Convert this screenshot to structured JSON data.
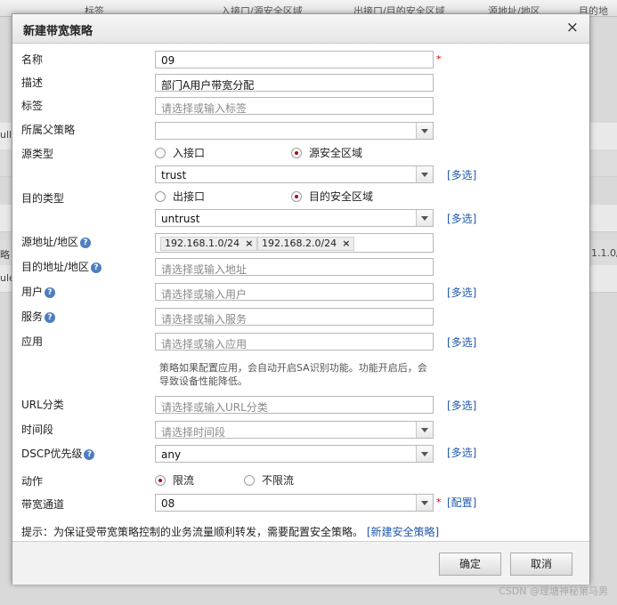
{
  "background": {
    "columns": [
      "标签",
      "入接口/源安全区域",
      "出接口/目的安全区域",
      "源地址/地区",
      "目的地"
    ],
    "row_texts": [
      "ull/全",
      "略",
      "ule",
      "1.1.0/"
    ]
  },
  "dialog": {
    "title": "新建带宽策略",
    "close_icon": "×"
  },
  "form": {
    "name": {
      "label": "名称",
      "value": "09",
      "required_mark": "*"
    },
    "desc": {
      "label": "描述",
      "value": "部门A用户带宽分配"
    },
    "tag": {
      "label": "标签",
      "placeholder": "请选择或输入标签"
    },
    "parent": {
      "label": "所属父策略",
      "value": ""
    },
    "src_type": {
      "label": "源类型",
      "options": [
        "入接口",
        "源安全区域"
      ],
      "selected": "源安全区域",
      "select_value": "trust",
      "multi_link": "[多选]"
    },
    "dst_type": {
      "label": "目的类型",
      "options": [
        "出接口",
        "目的安全区域"
      ],
      "selected": "目的安全区域",
      "select_value": "untrust",
      "multi_link": "[多选]"
    },
    "src_addr": {
      "label": "源地址/地区",
      "tags": [
        "192.168.1.0/24",
        "192.168.2.0/24"
      ],
      "remove_glyph": "×"
    },
    "dst_addr": {
      "label": "目的地址/地区",
      "placeholder": "请选择或输入地址"
    },
    "user": {
      "label": "用户",
      "placeholder": "请选择或输入用户",
      "multi_link": "[多选]"
    },
    "service": {
      "label": "服务",
      "placeholder": "请选择或输入服务"
    },
    "app": {
      "label": "应用",
      "placeholder": "请选择或输入应用",
      "multi_link": "[多选]",
      "note": "策略如果配置应用，会自动开启SA识别功能。功能开启后，会导致设备性能降低。"
    },
    "url": {
      "label": "URL分类",
      "placeholder": "请选择或输入URL分类",
      "multi_link": "[多选]"
    },
    "time": {
      "label": "时间段",
      "placeholder": "请选择时间段"
    },
    "dscp": {
      "label": "DSCP优先级",
      "value": "any",
      "multi_link": "[多选]"
    },
    "action": {
      "label": "动作",
      "options": [
        "限流",
        "不限流"
      ],
      "selected": "限流"
    },
    "channel": {
      "label": "带宽通道",
      "value": "08",
      "required_mark": "*",
      "config_link": "[配置]"
    },
    "help_glyph": "?"
  },
  "tip": {
    "text": "提示：为保证受带宽策略控制的业务流量顺利转发，需要配置安全策略。",
    "link": "[新建安全策略]"
  },
  "buttons": {
    "ok": "确定",
    "cancel": "取消"
  },
  "watermark": "CSDN @理塘神秘第马男"
}
